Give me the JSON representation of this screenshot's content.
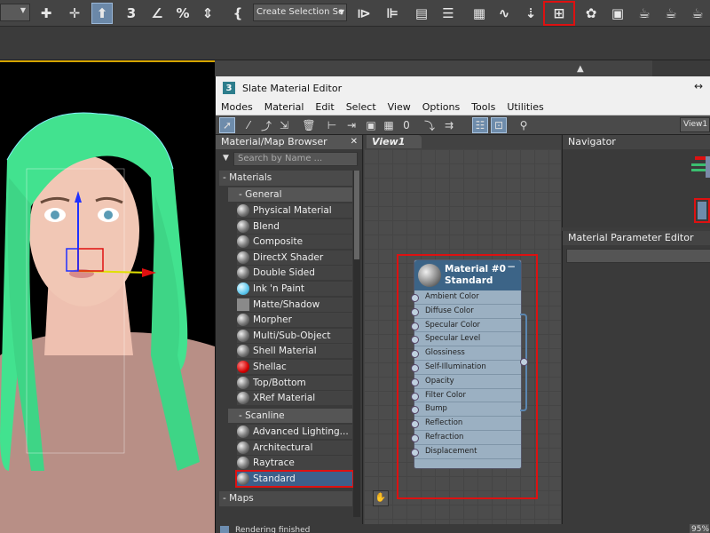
{
  "main_toolbar": {
    "selection_set": "Create Selection Se",
    "icons": [
      "dropdown-icon",
      "snap-icon",
      "move-icon",
      "select-object-icon",
      "snap3-icon",
      "angle-snap-icon",
      "percent-snap-icon",
      "spinner-snap-icon",
      "edit-named-sel-icon",
      "mirror-icon",
      "align-icon",
      "scene-explorer-icon",
      "layers-icon",
      "ribbon-icon",
      "curve-editor-icon",
      "schematic-view-icon",
      "compact-material-icon",
      "slate-material-editor-icon",
      "render-setup-icon",
      "rendered-frame-icon",
      "render-icon",
      "render-iterative-icon"
    ]
  },
  "sme": {
    "title": "Slate Material Editor",
    "logo": "3",
    "menu": [
      "Modes",
      "Material",
      "Edit",
      "Select",
      "View",
      "Options",
      "Tools",
      "Utilities"
    ],
    "view_combo": "View1"
  },
  "browser": {
    "header": "Material/Map Browser",
    "search_placeholder": "Search by Name ...",
    "materials_group": "- Materials",
    "general_group": "- General",
    "general_items": [
      {
        "label": "Physical Material",
        "swatch": "sphere"
      },
      {
        "label": "Blend",
        "swatch": "sphere"
      },
      {
        "label": "Composite",
        "swatch": "sphere"
      },
      {
        "label": "DirectX Shader",
        "swatch": "sphere"
      },
      {
        "label": "Double Sided",
        "swatch": "sphere"
      },
      {
        "label": "Ink 'n Paint",
        "swatch": "blue"
      },
      {
        "label": "Matte/Shadow",
        "swatch": "grey"
      },
      {
        "label": "Morpher",
        "swatch": "sphere"
      },
      {
        "label": "Multi/Sub-Object",
        "swatch": "sphere"
      },
      {
        "label": "Shell Material",
        "swatch": "sphere"
      },
      {
        "label": "Shellac",
        "swatch": "red"
      },
      {
        "label": "Top/Bottom",
        "swatch": "sphere"
      },
      {
        "label": "XRef Material",
        "swatch": "sphere"
      }
    ],
    "scanline_group": "- Scanline",
    "scanline_items": [
      {
        "label": "Advanced Lighting...",
        "swatch": "sphere"
      },
      {
        "label": "Architectural",
        "swatch": "sphere"
      },
      {
        "label": "Raytrace",
        "swatch": "sphere"
      },
      {
        "label": "Standard",
        "swatch": "sphere",
        "selected": true
      }
    ],
    "maps_group": "- Maps"
  },
  "view": {
    "tab": "View1",
    "node": {
      "name": "Material #0",
      "type": "Standard",
      "slots": [
        "Ambient Color",
        "Diffuse Color",
        "Specular Color",
        "Specular Level",
        "Glossiness",
        "Self-Illumination",
        "Opacity",
        "Filter Color",
        "Bump",
        "Reflection",
        "Refraction",
        "Displacement"
      ]
    }
  },
  "navigator": {
    "header": "Navigator"
  },
  "param_editor": {
    "header": "Material Parameter Editor"
  },
  "status": {
    "text": "Rendering finished",
    "zoom": "95%"
  }
}
